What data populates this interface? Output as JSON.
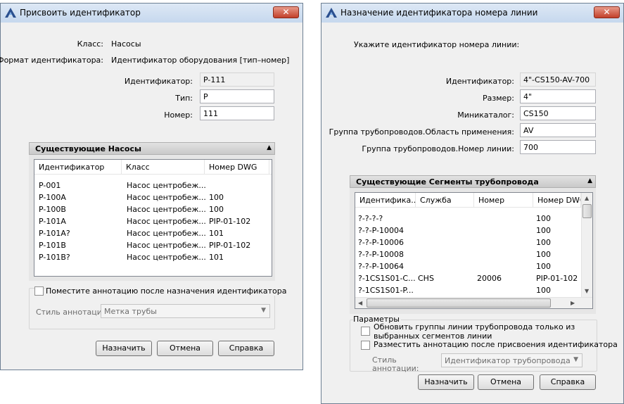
{
  "dlg1": {
    "title": "Присвоить идентификатор",
    "class_label": "Класс:",
    "class_value": "Насосы",
    "format_label": "Формат идентификатора:",
    "format_value": "Идентификатор оборудования [тип–номер]",
    "id_label": "Идентификатор:",
    "id_value": "P-111",
    "type_label": "Тип:",
    "type_value": "P",
    "num_label": "Номер:",
    "num_value": "111",
    "section_title": "Существующие Насосы",
    "columns": [
      "Идентификатор",
      "Класс",
      "Номер DWG"
    ],
    "rows": [
      [
        "P-001",
        "Насос центробеж...",
        ""
      ],
      [
        "P-100A",
        "Насос центробеж...",
        "100"
      ],
      [
        "P-100B",
        "Насос центробеж...",
        "100"
      ],
      [
        "P-101A",
        "Насос центробеж...",
        "PIP-01-102"
      ],
      [
        "P-101A?",
        "Насос центробеж...",
        "101"
      ],
      [
        "P-101B",
        "Насос центробеж...",
        "PIP-01-102"
      ],
      [
        "P-101B?",
        "Насос центробеж...",
        "101"
      ]
    ],
    "annot_check_label": "Поместите аннотацию после назначения идентификатора",
    "annot_style_label": "Стиль аннотации:",
    "annot_style_value": "Метка трубы",
    "btn_assign": "Назначить",
    "btn_cancel": "Отмена",
    "btn_help": "Справка"
  },
  "dlg2": {
    "title": "Назначение идентификатора номера линии",
    "prompt": "Укажите идентификатор номера линии:",
    "id_label": "Идентификатор:",
    "id_value": "4\"-CS150-AV-700",
    "size_label": "Размер:",
    "size_value": "4\"",
    "minicat_label": "Миникаталог:",
    "minicat_value": "CS150",
    "area_label": "Группа трубопроводов.Область применения:",
    "area_value": "AV",
    "line_label": "Группа трубопроводов.Номер линии:",
    "line_value": "700",
    "section_title": "Существующие Сегменты трубопровода",
    "columns": [
      "Идентифика...",
      "Служба",
      "Номер",
      "Номер DWG"
    ],
    "rows": [
      [
        "?-?-?-?",
        "",
        "",
        "100"
      ],
      [
        "?-?-P-10004",
        "",
        "",
        "100"
      ],
      [
        "?-?-P-10006",
        "",
        "",
        "100"
      ],
      [
        "?-?-P-10008",
        "",
        "",
        "100"
      ],
      [
        "?-?-P-10064",
        "",
        "",
        "100"
      ],
      [
        "?-1CS1S01-C...",
        "CHS",
        "20006",
        "PIP-01-102"
      ],
      [
        "?-1CS1S01-P...",
        "",
        "",
        "100"
      ]
    ],
    "params_label": "Параметры",
    "chk_update_label": "Обновить группы линии трубопровода только из выбранных сегментов линии",
    "chk_annot_label": "Разместить аннотацию после присвоения идентификатора",
    "annot_style_label": "Стиль аннотации:",
    "annot_style_value": "Идентификатор трубопровода",
    "btn_assign": "Назначить",
    "btn_cancel": "Отмена",
    "btn_help": "Справка"
  },
  "icons": {
    "app_icon": "autocad-plant-logo-icon",
    "close": "close-icon",
    "collapse": "collapse-up-icon",
    "dropdown": "chevron-down-icon"
  },
  "colors": {
    "close_button": "#c2402a",
    "title_bar": "#c6d8ee",
    "dialog_bg": "#f0f0f0"
  }
}
